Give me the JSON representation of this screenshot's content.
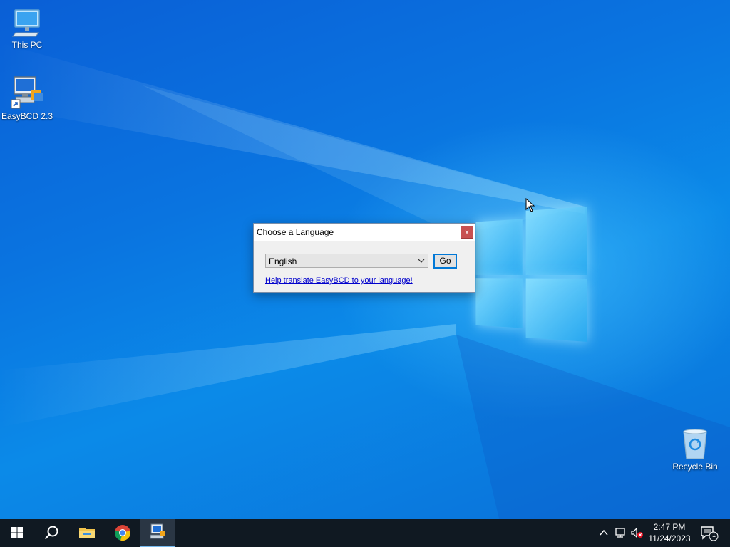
{
  "desktop": {
    "icons": [
      {
        "label": "This PC"
      },
      {
        "label": "EasyBCD 2.3"
      },
      {
        "label": "Recycle Bin"
      }
    ]
  },
  "dialog": {
    "title": "Choose a Language",
    "close_label": "x",
    "language_select": {
      "value": "English"
    },
    "go_label": "Go",
    "help_link": "Help translate EasyBCD to your language!"
  },
  "taskbar": {
    "items": [
      "start-icon",
      "search-icon",
      "file-explorer-icon",
      "chrome-icon",
      "easybcd-icon"
    ],
    "tray": {
      "time": "2:47 PM",
      "date": "11/24/2023",
      "notification_count": "1"
    }
  },
  "colors": {
    "accent": "#0078d7",
    "taskbar": "#101922",
    "close_button": "#c75050",
    "link": "#0000cc"
  }
}
